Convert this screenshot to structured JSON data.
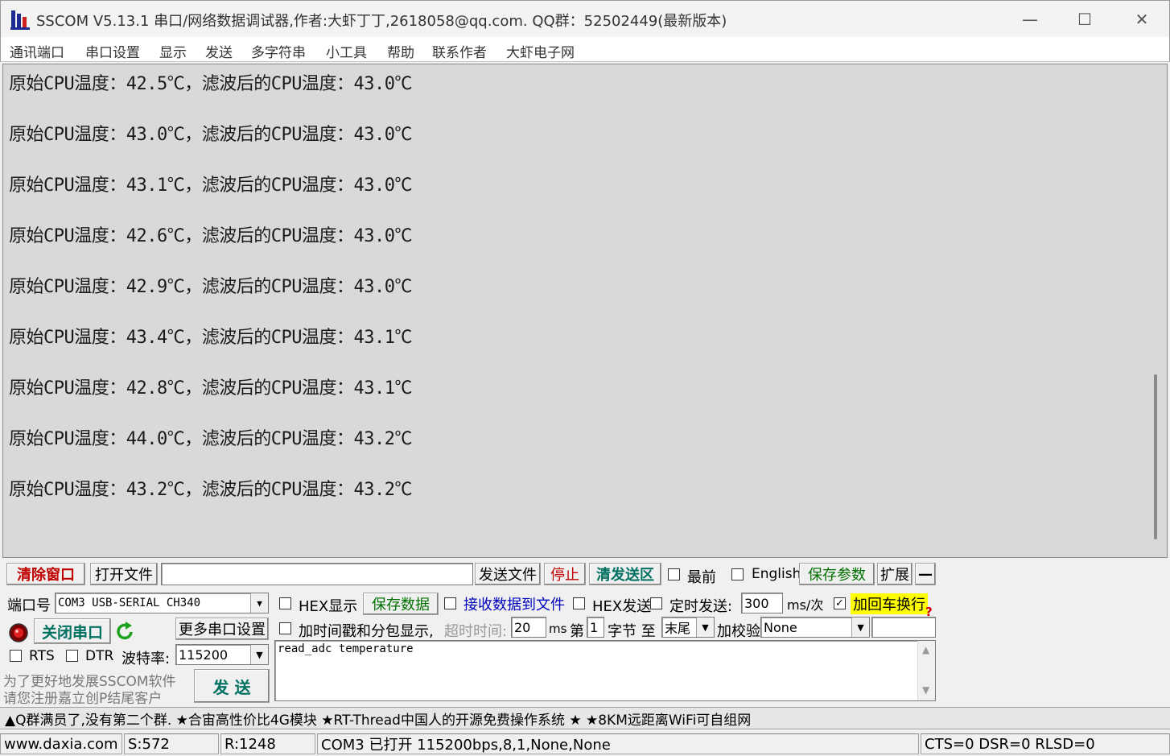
{
  "window": {
    "title": "SSCOM V5.13.1 串口/网络数据调试器,作者:大虾丁丁,2618058@qq.com. QQ群：52502449(最新版本)",
    "minimize": "—",
    "maximize": "☐",
    "close": "✕"
  },
  "menu": [
    "通讯端口",
    "串口设置",
    "显示",
    "发送",
    "多字符串",
    "小工具",
    "帮助",
    "联系作者",
    "大虾电子网"
  ],
  "receive": {
    "lines": [
      "原始CPU温度：42.5℃，滤波后的CPU温度：43.0℃",
      "原始CPU温度：43.0℃，滤波后的CPU温度：43.0℃",
      "原始CPU温度：43.1℃，滤波后的CPU温度：43.0℃",
      "原始CPU温度：42.6℃，滤波后的CPU温度：43.0℃",
      "原始CPU温度：42.9℃，滤波后的CPU温度：43.0℃",
      "原始CPU温度：43.4℃，滤波后的CPU温度：43.1℃",
      "原始CPU温度：42.8℃，滤波后的CPU温度：43.1℃",
      "原始CPU温度：44.0℃，滤波后的CPU温度：43.2℃",
      "原始CPU温度：43.2℃，滤波后的CPU温度：43.2℃"
    ]
  },
  "toolbar": {
    "clear_window": "清除窗口",
    "open_file": "打开文件",
    "file_path": "",
    "send_file": "发送文件",
    "stop": "停止",
    "clear_send": "清发送区",
    "last": "最前",
    "english": "English",
    "save_params": "保存参数",
    "expand": "扩展",
    "collapse": "—"
  },
  "port": {
    "port_label": "端口号",
    "port_value": "COM3 USB-SERIAL CH340",
    "close_port": "关闭串口",
    "more_settings": "更多串口设置",
    "rts": "RTS",
    "dtr": "DTR",
    "baud_label": "波特率:",
    "baud_value": "115200",
    "promo1": "为了更好地发展SSCOM软件",
    "promo2": "请您注册嘉立创P结尾客户"
  },
  "options": {
    "hex_display": "HEX显示",
    "save_data": "保存数据",
    "recv_to_file": "接收数据到文件",
    "hex_send": "HEX发送",
    "timed_send": "定时发送:",
    "interval": "300",
    "interval_unit": "ms/次",
    "add_crlf": "加回车换行",
    "add_timestamp": "加时间戳和分包显示,",
    "timeout_label": "超时时间:",
    "timeout_value": "20",
    "timeout_unit": "ms",
    "byte_prefix": "第",
    "byte_from": "1",
    "byte_mid": "字节 至",
    "byte_to": "末尾",
    "checksum_label": "加校验",
    "checksum_value": "None",
    "help": "?"
  },
  "send": {
    "text": "read_adc temperature",
    "send_button": "发  送"
  },
  "ticker": "▲Q群满员了,没有第二个群. ★合宙高性价比4G模块 ★RT-Thread中国人的开源免费操作系统 ★ ★8KM远距离WiFi可自组网",
  "status": {
    "site": "www.daxia.com",
    "sent": "S:572",
    "received": "R:1248",
    "port_state": "COM3 已打开  115200bps,8,1,None,None",
    "lines": "CTS=0 DSR=0 RLSD=0"
  },
  "colors": {
    "red_text": "#c00000",
    "green_text": "#007000",
    "teal_text": "#007060",
    "blue_text": "#0000c0",
    "highlight": "#ffff00",
    "receive_bg": "#d9d9d9"
  }
}
